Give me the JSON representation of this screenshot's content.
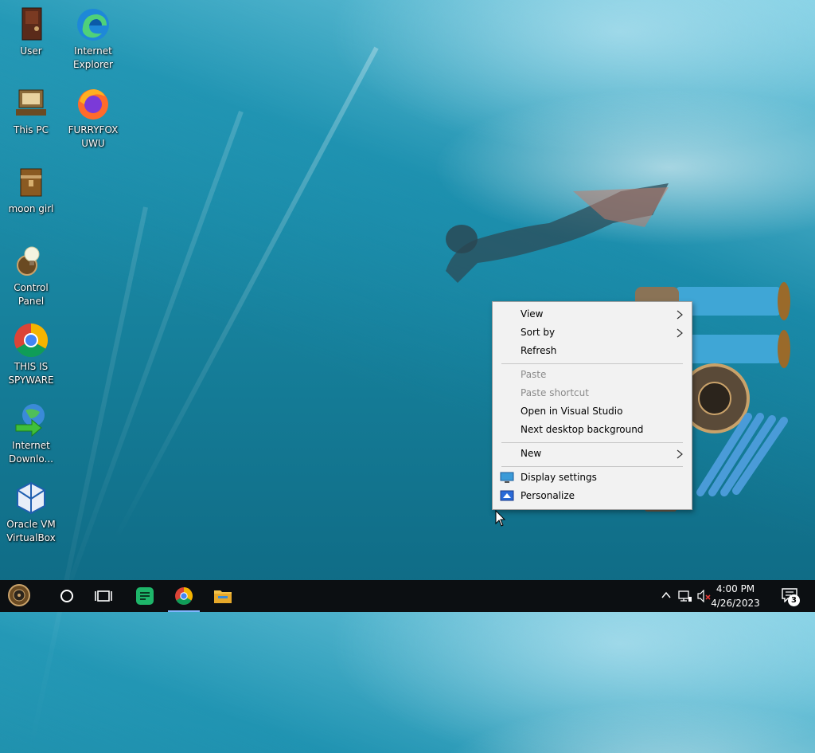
{
  "desktop": {
    "icons": [
      {
        "label": "User",
        "icon": "cabinet-icon"
      },
      {
        "label": "Internet Explorer",
        "icon": "edge-icon"
      },
      {
        "label": "This PC",
        "icon": "steampunk-computer-icon"
      },
      {
        "label": "FURRYFOX UWU",
        "icon": "firefox-icon"
      },
      {
        "label": "moon girl",
        "icon": "trunk-icon"
      },
      {
        "label": "Control Panel",
        "icon": "lightbulb-gear-icon"
      },
      {
        "label": "THIS IS SPYWARE",
        "icon": "chrome-icon"
      },
      {
        "label": "Internet Downlo...",
        "icon": "idm-globe-icon"
      },
      {
        "label": "Oracle VM VirtualBox",
        "icon": "virtualbox-cube-icon"
      }
    ]
  },
  "context_menu": {
    "view": "View",
    "sort_by": "Sort by",
    "refresh": "Refresh",
    "paste": "Paste",
    "paste_shortcut": "Paste shortcut",
    "open_visual_studio": "Open in Visual Studio",
    "next_background": "Next desktop background",
    "new": "New",
    "display_settings": "Display settings",
    "personalize": "Personalize"
  },
  "taskbar": {
    "time": "4:00 PM",
    "date": "4/26/2023",
    "notification_count": "3",
    "pinned": [
      "start-button",
      "cortana-circle",
      "task-view",
      "notes-app",
      "chrome",
      "file-explorer"
    ],
    "accent_color": "#7fb6ff"
  }
}
